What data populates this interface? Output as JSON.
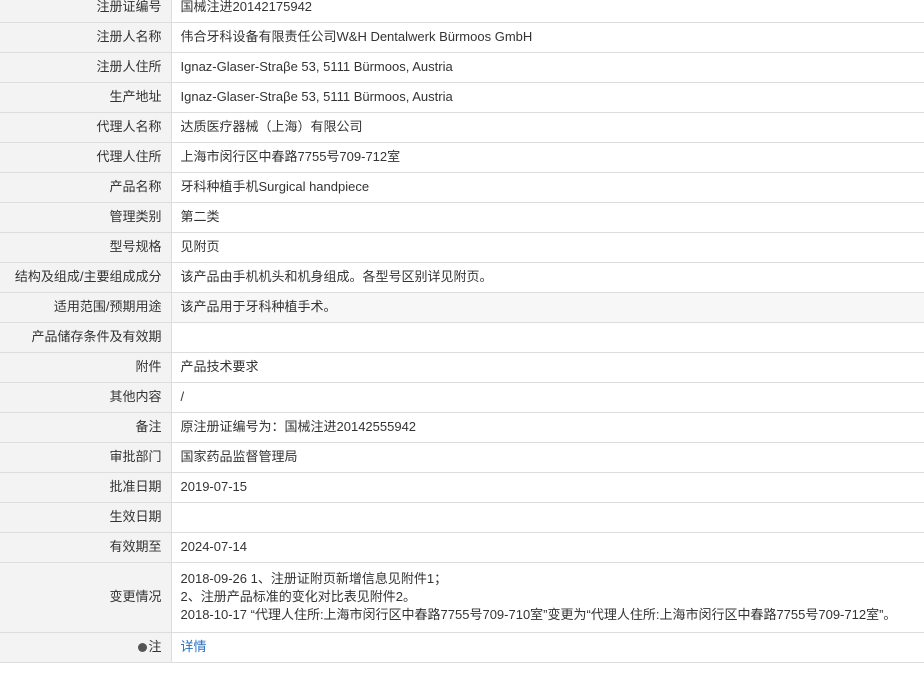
{
  "rows": [
    {
      "label": "注册证编号",
      "value": "国械注进20142175942"
    },
    {
      "label": "注册人名称",
      "value": "伟合牙科设备有限责任公司W&H Dentalwerk Bürmoos GmbH"
    },
    {
      "label": "注册人住所",
      "value": "Ignaz-Glaser-Straβe 53, 5111 Bürmoos, Austria"
    },
    {
      "label": "生产地址",
      "value": "Ignaz-Glaser-Straβe 53, 5111 Bürmoos, Austria"
    },
    {
      "label": "代理人名称",
      "value": "达质医疗器械（上海）有限公司"
    },
    {
      "label": "代理人住所",
      "value": "上海市闵行区中春路7755号709-712室"
    },
    {
      "label": "产品名称",
      "value": "牙科种植手机Surgical handpiece"
    },
    {
      "label": "管理类别",
      "value": "第二类"
    },
    {
      "label": "型号规格",
      "value": "见附页"
    },
    {
      "label": "结构及组成/主要组成成分",
      "value": "该产品由手机机头和机身组成。各型号区别详见附页。"
    },
    {
      "label": "适用范围/预期用途",
      "value": "该产品用于牙科种植手术。"
    },
    {
      "label": "产品储存条件及有效期",
      "value": ""
    },
    {
      "label": "附件",
      "value": "产品技术要求"
    },
    {
      "label": "其他内容",
      "value": "/"
    },
    {
      "label": "备注",
      "value": "原注册证编号为：国械注进20142555942"
    },
    {
      "label": "审批部门",
      "value": "国家药品监督管理局"
    },
    {
      "label": "批准日期",
      "value": "2019-07-15"
    },
    {
      "label": "生效日期",
      "value": ""
    },
    {
      "label": "有效期至",
      "value": "2024-07-14"
    }
  ],
  "change": {
    "label": "变更情况",
    "lines": [
      "2018-09-26 1、注册证附页新增信息见附件1；",
      "2、注册产品标准的变化对比表见附件2。",
      "2018-10-17 “代理人住所:上海市闵行区中春路7755号709-710室”变更为“代理人住所:上海市闵行区中春路7755号709-712室”。"
    ]
  },
  "note": {
    "label": "注",
    "icon": "info-icon",
    "link_text": "详情"
  },
  "colors": {
    "label_bg": "#f3f3f3",
    "border": "#dddddd",
    "link": "#2a6fc0"
  }
}
